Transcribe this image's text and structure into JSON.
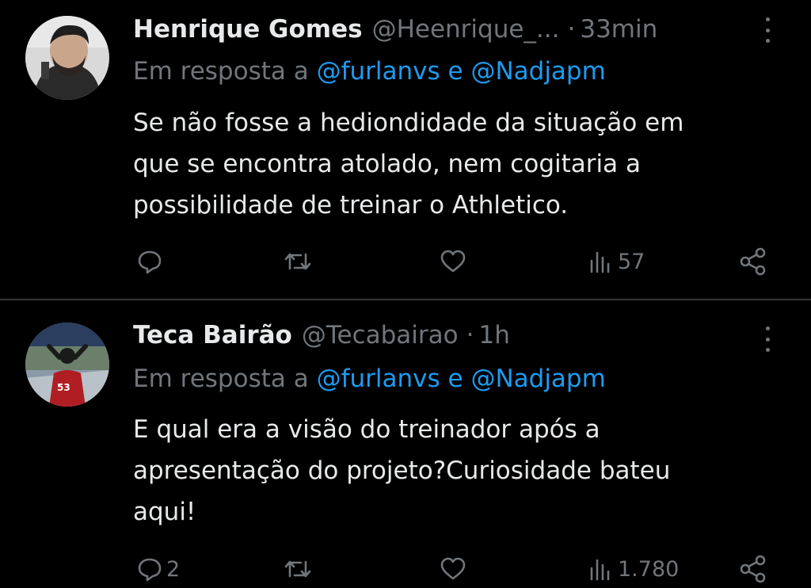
{
  "tweets": [
    {
      "name": "Henrique Gomes",
      "handle": "@Heenrique_...",
      "separator": "·",
      "time": "33min",
      "reply_prefix": "Em resposta a",
      "mention1": "@furlanvs",
      "reply_and": "e",
      "mention2": "@Nadjapm",
      "text_lines": [
        "Se não fosse a hediondidade da situação em",
        "que se encontra atolado, nem cogitaria a",
        "possibilidade de treinar o Athletico."
      ],
      "reply_count": "",
      "views": "57"
    },
    {
      "name": "Teca Bairão",
      "handle": "@Tecabairao",
      "separator": "·",
      "time": "1h",
      "reply_prefix": "Em resposta a",
      "mention1": "@furlanvs",
      "reply_and": "e",
      "mention2": "@Nadjapm",
      "text_lines": [
        "E qual era a visão do treinador após a",
        "apresentação do projeto?Curiosidade bateu",
        "aqui!"
      ],
      "reply_count": "2",
      "views": "1.780"
    }
  ],
  "colors": {
    "background": "#000000",
    "text": "#e7e9ea",
    "secondary": "#71767b",
    "link": "#1d9bf0",
    "divider": "#2f3336"
  },
  "icons": [
    "more-vertical-icon",
    "reply-icon",
    "retweet-icon",
    "like-icon",
    "views-icon",
    "share-icon"
  ]
}
